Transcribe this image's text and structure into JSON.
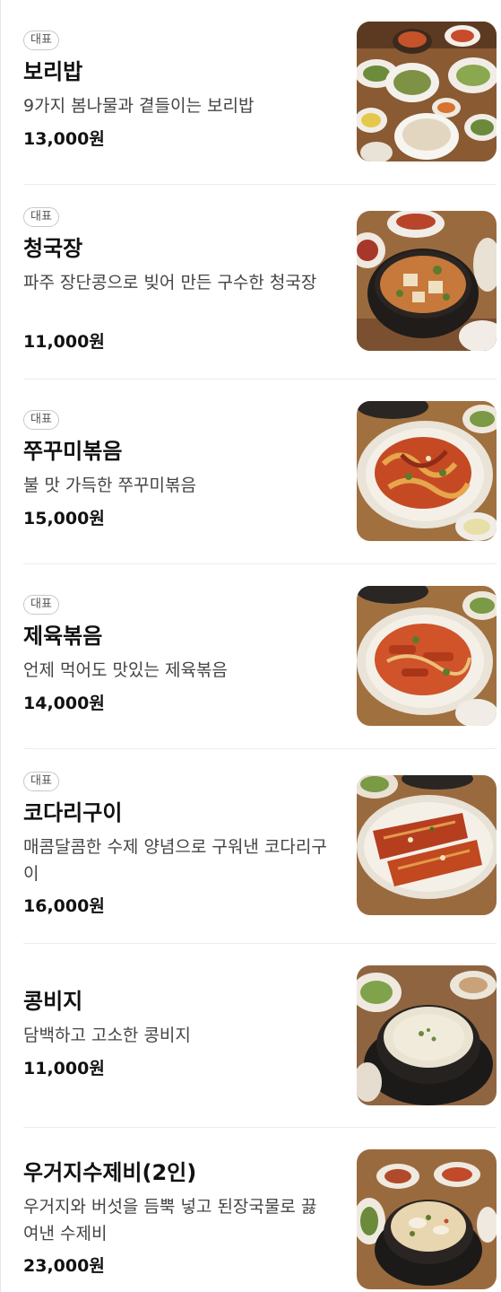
{
  "menu": [
    {
      "badge": "대표",
      "name": "보리밥",
      "desc": "9가지 봄나물과 곁들이는 보리밥",
      "price": "13,000원",
      "image": "barley-rice-bowl"
    },
    {
      "badge": "대표",
      "name": "청국장",
      "desc": "파주 장단콩으로 빚어 만든 구수한 청국장",
      "price": "11,000원",
      "image": "cheonggukjang-stew"
    },
    {
      "badge": "대표",
      "name": "쭈꾸미볶음",
      "desc": "불 맛 가득한 쭈꾸미볶음",
      "price": "15,000원",
      "image": "stir-fried-octopus"
    },
    {
      "badge": "대표",
      "name": "제육볶음",
      "desc": "언제 먹어도 맛있는 제육볶음",
      "price": "14,000원",
      "image": "stir-fried-pork"
    },
    {
      "badge": "대표",
      "name": "코다리구이",
      "desc": "매콤달콤한 수제 양념으로 구워낸 코다리구이",
      "price": "16,000원",
      "image": "grilled-pollock"
    },
    {
      "badge": "",
      "name": "콩비지",
      "desc": "담백하고 고소한 콩비지",
      "price": "11,000원",
      "image": "soybean-curd-stew"
    },
    {
      "badge": "",
      "name": "우거지수제비(2인)",
      "desc": "우거지와 버섯을 듬뿍 넣고 된장국물로 끓여낸 수제비",
      "price": "23,000원",
      "image": "sujebi-soup"
    }
  ]
}
